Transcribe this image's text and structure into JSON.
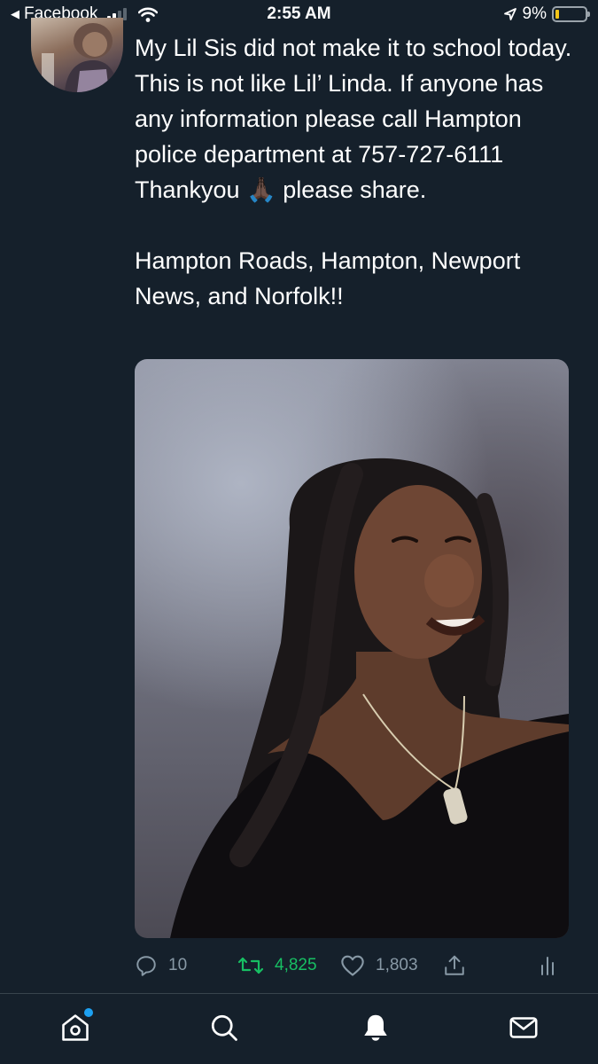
{
  "status_bar": {
    "back_app": "Facebook",
    "time": "2:55 AM",
    "battery": "9%",
    "battery_level": 0.09,
    "battery_color": "#f5c518"
  },
  "tweet": {
    "text": "My Lil Sis did not make it to school today. This is not like Lil’ Linda. If anyone has any information please call Hampton police department at 757-727-6111 Thankyou 🙏🏿 please share.\n\nHampton Roads, Hampton, Newport News, and Norfolk!!",
    "photo_alt": "",
    "replies": "10",
    "retweets": "4,825",
    "likes": "1,803"
  },
  "colors": {
    "background": "#15202b",
    "muted": "#8899a6",
    "retweet_active": "#17bf63",
    "accent": "#1da1f2"
  },
  "icons": {
    "reply": "reply-icon",
    "retweet": "retweet-icon",
    "like": "heart-icon",
    "share": "share-icon",
    "analytics": "analytics-icon",
    "home": "home-icon",
    "search": "search-icon",
    "notifications": "bell-icon",
    "messages": "mail-icon"
  }
}
